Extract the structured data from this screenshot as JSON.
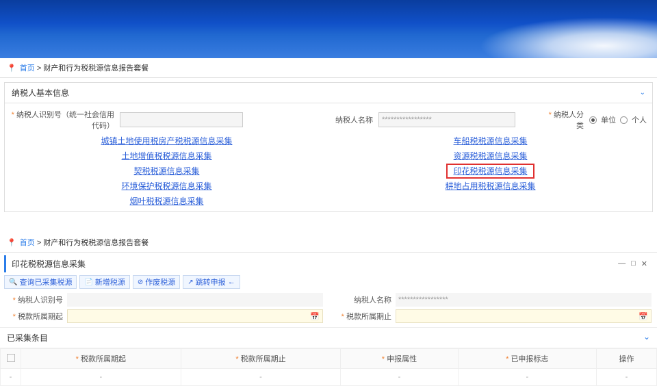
{
  "breadcrumb": {
    "home": "首页",
    "path": "财产和行为税税源信息报告套餐"
  },
  "panel1": {
    "title": "纳税人基本信息",
    "id_label": "纳税人识别号（统一社会信用代码）",
    "id_value": "",
    "name_label": "纳税人名称",
    "name_value": "*****************",
    "cat_label": "纳税人分类",
    "cat_opt1": "单位",
    "cat_opt2": "个人"
  },
  "links": {
    "left": [
      "城镇土地使用税房产税税源信息采集",
      "土地增值税税源信息采集",
      "契税税源信息采集",
      "环境保护税税源信息采集",
      "烟叶税税源信息采集"
    ],
    "right": [
      "车船税税源信息采集",
      "资源税税源信息采集",
      "印花税税源信息采集",
      "耕地占用税税源信息采集"
    ]
  },
  "sub": {
    "title": "印花税税源信息采集",
    "btn_query": "查询已采集税源",
    "btn_new": "新增税源",
    "btn_void": "作废税源",
    "btn_jump": "跳转申报",
    "btn_jump_note": "←",
    "id_label": "纳税人识别号",
    "id_value": "",
    "name_label": "纳税人名称",
    "name_value": "*****************",
    "period_start": "税款所属期起",
    "period_end": "税款所属期止"
  },
  "collected": {
    "title": "已采集条目"
  },
  "table": {
    "cols": [
      "",
      "税款所属期起",
      "税款所属期止",
      "申报属性",
      "已申报标志",
      "操作"
    ],
    "row": [
      "-",
      "-",
      "-",
      "-",
      "-",
      "-"
    ]
  }
}
